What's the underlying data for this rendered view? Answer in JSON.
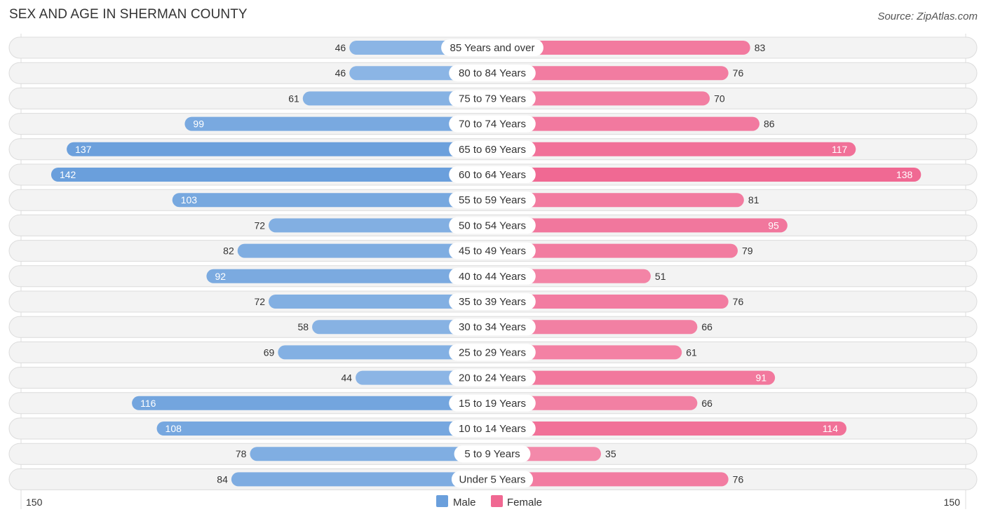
{
  "header": {
    "title": "SEX AND AGE IN SHERMAN COUNTY",
    "source": "Source: ZipAtlas.com"
  },
  "chart_data": {
    "type": "bar",
    "orientation": "horizontal-diverging",
    "title": "SEX AND AGE IN SHERMAN COUNTY",
    "source": "Source: ZipAtlas.com",
    "categories": [
      "85 Years and over",
      "80 to 84 Years",
      "75 to 79 Years",
      "70 to 74 Years",
      "65 to 69 Years",
      "60 to 64 Years",
      "55 to 59 Years",
      "50 to 54 Years",
      "45 to 49 Years",
      "40 to 44 Years",
      "35 to 39 Years",
      "30 to 34 Years",
      "25 to 29 Years",
      "20 to 24 Years",
      "15 to 19 Years",
      "10 to 14 Years",
      "5 to 9 Years",
      "Under 5 Years"
    ],
    "series": [
      {
        "name": "Male",
        "color": "#6a9fdc",
        "values": [
          46,
          46,
          61,
          99,
          137,
          142,
          103,
          72,
          82,
          92,
          72,
          58,
          69,
          44,
          116,
          108,
          78,
          84
        ]
      },
      {
        "name": "Female",
        "color": "#f06892",
        "values": [
          83,
          76,
          70,
          86,
          117,
          138,
          81,
          95,
          79,
          51,
          76,
          66,
          61,
          91,
          66,
          114,
          35,
          76
        ]
      }
    ],
    "axis": {
      "left_label": "150",
      "right_label": "150",
      "max": 150
    },
    "legend": {
      "position": "bottom-center",
      "items": [
        "Male",
        "Female"
      ]
    },
    "grid": false
  }
}
